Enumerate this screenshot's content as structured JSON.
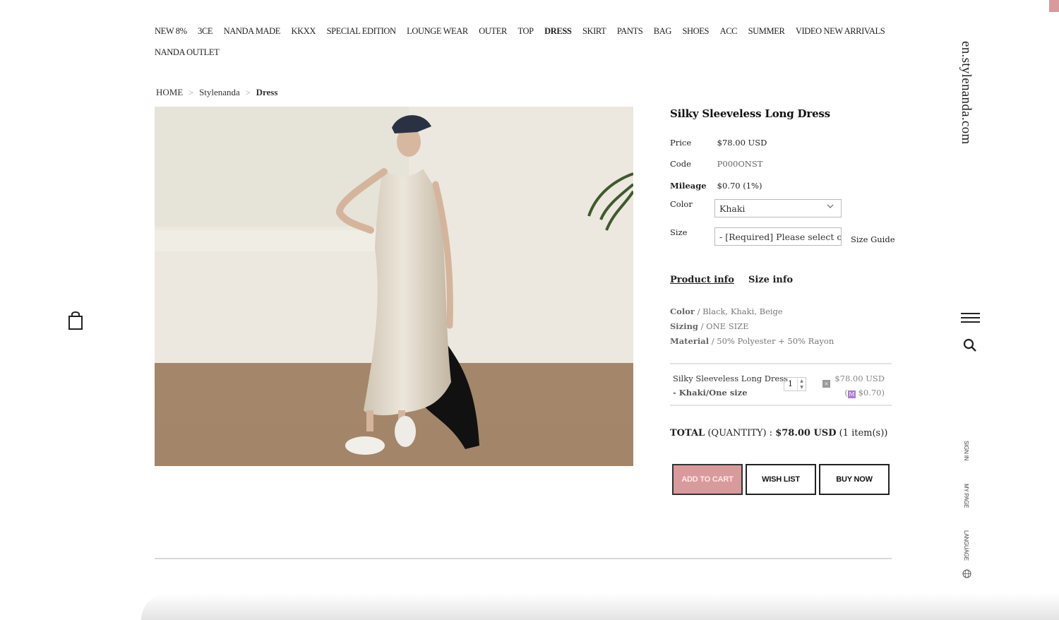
{
  "nav": {
    "items": [
      {
        "label": "NEW 8%",
        "active": false
      },
      {
        "label": "3CE",
        "active": false
      },
      {
        "label": "NANDA MADE",
        "active": false
      },
      {
        "label": "KKXX",
        "active": false
      },
      {
        "label": "SPECIAL EDITION",
        "active": false
      },
      {
        "label": "LOUNGE WEAR",
        "active": false
      },
      {
        "label": "OUTER",
        "active": false
      },
      {
        "label": "TOP",
        "active": false
      },
      {
        "label": "DRESS",
        "active": true
      },
      {
        "label": "SKIRT",
        "active": false
      },
      {
        "label": "PANTS",
        "active": false
      },
      {
        "label": "BAG",
        "active": false
      },
      {
        "label": "SHOES",
        "active": false
      },
      {
        "label": "ACC",
        "active": false
      },
      {
        "label": "SUMMER",
        "active": false
      },
      {
        "label": "VIDEO NEW ARRIVALS",
        "active": false
      },
      {
        "label": "NANDA OUTLET",
        "active": false
      }
    ]
  },
  "breadcrumb": {
    "home": "HOME",
    "brand": "Stylenanda",
    "current": "Dress",
    "separator": ">"
  },
  "product": {
    "image_alt": "Model wearing silky sleeveless long dress in khaki",
    "name": "Silky Sleeveless Long Dress",
    "price_label": "Price",
    "price": "$78.00 USD",
    "code_label": "Code",
    "code": "P000ONST",
    "mileage_label": "Mileage",
    "mileage": "$0.70 (1%)",
    "color_label": "Color",
    "color_value": "Khaki",
    "size_label": "Size",
    "size_placeholder": "- [Required] Please select opt",
    "size_guide": "Size Guide"
  },
  "tabs": [
    {
      "label": "Product info",
      "active": true
    },
    {
      "label": "Size info",
      "active": false
    }
  ],
  "info": {
    "color_key": "Color",
    "color_val": "/ Black, Khaki, Beige",
    "sizing_key": "Sizing",
    "sizing_val": "/ ONE SIZE",
    "material_key": "Material",
    "material_val": "/ 50% Polyester + 50% Rayon"
  },
  "selected_item": {
    "name": "Silky Sleeveless Long Dress",
    "option": "- Khaki/One size",
    "quantity": "1",
    "price": "$78.00 USD",
    "mileage_open": "(",
    "mileage_icon": "M",
    "mileage": "$0.70)",
    "remove_icon": "×"
  },
  "total": {
    "label": "TOTAL",
    "qty_label": "(QUANTITY) :",
    "amount": "$78.00 USD",
    "items": "(1 item(s))"
  },
  "buttons": {
    "add_to_cart": "ADD TO CART",
    "wish_list": "WISH LIST",
    "buy_now": "BUY NOW"
  },
  "sidebar": {
    "site_name": "en.stylenanda.com",
    "sign_in": "SIGN IN",
    "my_page": "MY PAGE",
    "language": "LANGUAGE"
  },
  "colors": {
    "accent": "#d99a9b",
    "mileage_icon": "#a77ad0"
  }
}
